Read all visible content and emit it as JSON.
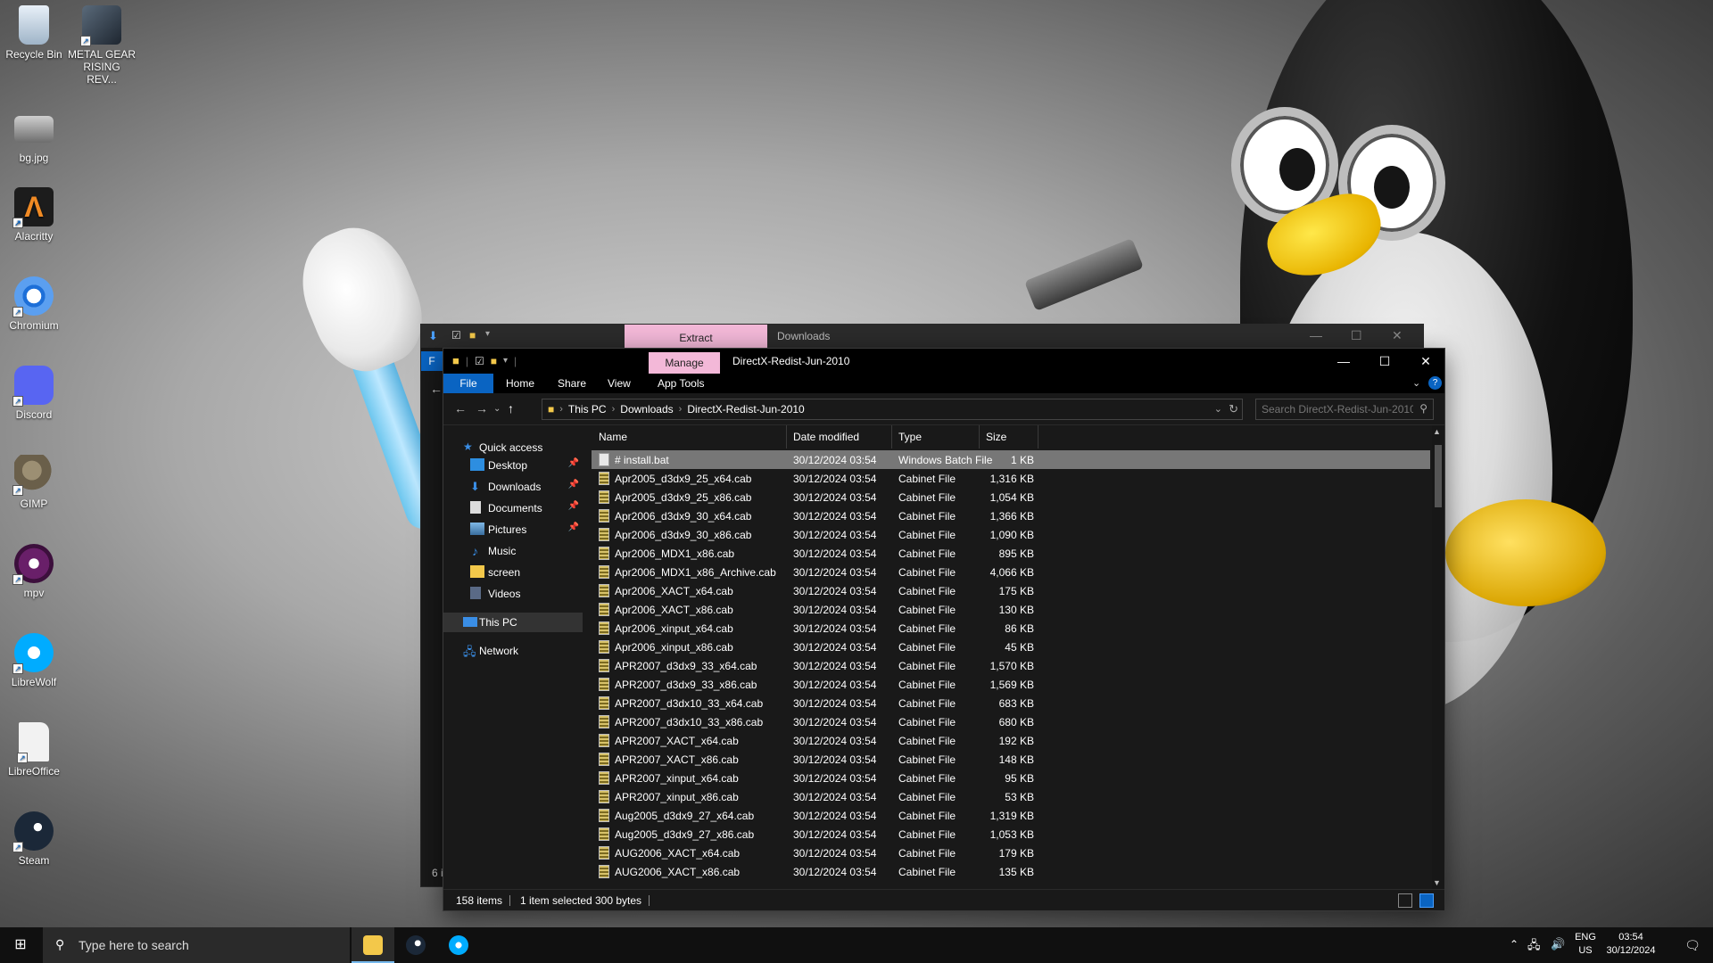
{
  "desktop": {
    "icons": [
      {
        "label": "Recycle Bin",
        "icon": "recycle-bin-icon"
      },
      {
        "label": "METAL GEAR RISING REV...",
        "icon": "game-icon"
      },
      {
        "label": "bg.jpg",
        "icon": "image-file-icon"
      },
      {
        "label": "Alacritty",
        "icon": "alacritty-icon"
      },
      {
        "label": "Chromium",
        "icon": "chromium-icon"
      },
      {
        "label": "Discord",
        "icon": "discord-icon"
      },
      {
        "label": "GIMP",
        "icon": "gimp-icon"
      },
      {
        "label": "mpv",
        "icon": "mpv-icon"
      },
      {
        "label": "LibreWolf",
        "icon": "librewolf-icon"
      },
      {
        "label": "LibreOffice",
        "icon": "libreoffice-icon"
      },
      {
        "label": "Steam",
        "icon": "steam-icon"
      }
    ]
  },
  "back_window": {
    "context_tab": "Extract",
    "title": "Downloads",
    "file_tab_letter": "F",
    "status_fragment": "6 i"
  },
  "window": {
    "context_tab": "Manage",
    "title": "DirectX-Redist-Jun-2010",
    "ribbon_tabs": [
      "File",
      "Home",
      "Share",
      "View",
      "App Tools"
    ],
    "breadcrumb": [
      "This PC",
      "Downloads",
      "DirectX-Redist-Jun-2010"
    ],
    "search_placeholder": "Search DirectX-Redist-Jun-2010",
    "nav": {
      "quick_access": "Quick access",
      "items": [
        "Desktop",
        "Downloads",
        "Documents",
        "Pictures",
        "Music",
        "screen",
        "Videos"
      ],
      "this_pc": "This PC",
      "network": "Network"
    },
    "columns": {
      "name": "Name",
      "date": "Date modified",
      "type": "Type",
      "size": "Size"
    },
    "files": [
      {
        "name": "# install.bat",
        "date": "30/12/2024 03:54",
        "type": "Windows Batch File",
        "size": "1 KB"
      },
      {
        "name": "Apr2005_d3dx9_25_x64.cab",
        "date": "30/12/2024 03:54",
        "type": "Cabinet File",
        "size": "1,316 KB"
      },
      {
        "name": "Apr2005_d3dx9_25_x86.cab",
        "date": "30/12/2024 03:54",
        "type": "Cabinet File",
        "size": "1,054 KB"
      },
      {
        "name": "Apr2006_d3dx9_30_x64.cab",
        "date": "30/12/2024 03:54",
        "type": "Cabinet File",
        "size": "1,366 KB"
      },
      {
        "name": "Apr2006_d3dx9_30_x86.cab",
        "date": "30/12/2024 03:54",
        "type": "Cabinet File",
        "size": "1,090 KB"
      },
      {
        "name": "Apr2006_MDX1_x86.cab",
        "date": "30/12/2024 03:54",
        "type": "Cabinet File",
        "size": "895 KB"
      },
      {
        "name": "Apr2006_MDX1_x86_Archive.cab",
        "date": "30/12/2024 03:54",
        "type": "Cabinet File",
        "size": "4,066 KB"
      },
      {
        "name": "Apr2006_XACT_x64.cab",
        "date": "30/12/2024 03:54",
        "type": "Cabinet File",
        "size": "175 KB"
      },
      {
        "name": "Apr2006_XACT_x86.cab",
        "date": "30/12/2024 03:54",
        "type": "Cabinet File",
        "size": "130 KB"
      },
      {
        "name": "Apr2006_xinput_x64.cab",
        "date": "30/12/2024 03:54",
        "type": "Cabinet File",
        "size": "86 KB"
      },
      {
        "name": "Apr2006_xinput_x86.cab",
        "date": "30/12/2024 03:54",
        "type": "Cabinet File",
        "size": "45 KB"
      },
      {
        "name": "APR2007_d3dx9_33_x64.cab",
        "date": "30/12/2024 03:54",
        "type": "Cabinet File",
        "size": "1,570 KB"
      },
      {
        "name": "APR2007_d3dx9_33_x86.cab",
        "date": "30/12/2024 03:54",
        "type": "Cabinet File",
        "size": "1,569 KB"
      },
      {
        "name": "APR2007_d3dx10_33_x64.cab",
        "date": "30/12/2024 03:54",
        "type": "Cabinet File",
        "size": "683 KB"
      },
      {
        "name": "APR2007_d3dx10_33_x86.cab",
        "date": "30/12/2024 03:54",
        "type": "Cabinet File",
        "size": "680 KB"
      },
      {
        "name": "APR2007_XACT_x64.cab",
        "date": "30/12/2024 03:54",
        "type": "Cabinet File",
        "size": "192 KB"
      },
      {
        "name": "APR2007_XACT_x86.cab",
        "date": "30/12/2024 03:54",
        "type": "Cabinet File",
        "size": "148 KB"
      },
      {
        "name": "APR2007_xinput_x64.cab",
        "date": "30/12/2024 03:54",
        "type": "Cabinet File",
        "size": "95 KB"
      },
      {
        "name": "APR2007_xinput_x86.cab",
        "date": "30/12/2024 03:54",
        "type": "Cabinet File",
        "size": "53 KB"
      },
      {
        "name": "Aug2005_d3dx9_27_x64.cab",
        "date": "30/12/2024 03:54",
        "type": "Cabinet File",
        "size": "1,319 KB"
      },
      {
        "name": "Aug2005_d3dx9_27_x86.cab",
        "date": "30/12/2024 03:54",
        "type": "Cabinet File",
        "size": "1,053 KB"
      },
      {
        "name": "AUG2006_XACT_x64.cab",
        "date": "30/12/2024 03:54",
        "type": "Cabinet File",
        "size": "179 KB"
      },
      {
        "name": "AUG2006_XACT_x86.cab",
        "date": "30/12/2024 03:54",
        "type": "Cabinet File",
        "size": "135 KB"
      }
    ],
    "status": {
      "count": "158 items",
      "selected": "1 item selected",
      "bytes": "300 bytes"
    }
  },
  "taskbar": {
    "search_placeholder": "Type here to search",
    "lang_line1": "ENG",
    "lang_line2": "US",
    "time": "03:54",
    "date": "30/12/2024"
  },
  "colors": {
    "accent": "#0a64c2",
    "context_tab": "#f3b8d8",
    "selection": "#777777"
  }
}
